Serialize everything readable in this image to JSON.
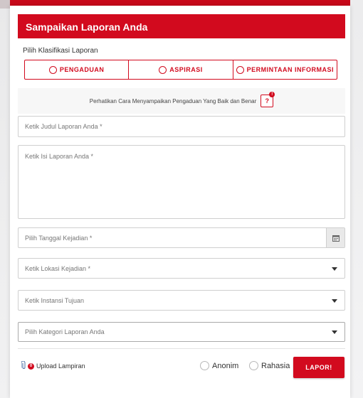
{
  "form": {
    "title": "Sampaikan Laporan Anda",
    "classification_label": "Pilih Klasifikasi Laporan",
    "classifications": [
      {
        "label": "PENGADUAN"
      },
      {
        "label": "ASPIRASI"
      },
      {
        "label": "PERMINTAAN INFORMASI"
      }
    ],
    "notice_text": "Perhatikan Cara Menyampaikan Pengaduan Yang Baik dan Benar",
    "help_label": "?",
    "help_badge": "!",
    "fields": {
      "title_placeholder": "Ketik Judul Laporan Anda *",
      "body_placeholder": "Ketik Isi Laporan Anda *",
      "date_placeholder": "Pilih Tanggal Kejadian *",
      "location_placeholder": "Ketik Lokasi Kejadian *",
      "agency_placeholder": "Ketik Instansi Tujuan",
      "category_placeholder": "Pilih Kategori Laporan Anda"
    },
    "upload_label": "Upload Lampiran",
    "upload_count": "0",
    "anonymous_label": "Anonim",
    "secret_label": "Rahasia",
    "submit_label": "LAPOR!"
  },
  "colors": {
    "accent": "#d20a1e",
    "border": "#cfcfcf"
  },
  "icons": {
    "calendar": "calendar-icon",
    "caret": "caret-down-icon",
    "clip": "paperclip-icon"
  }
}
